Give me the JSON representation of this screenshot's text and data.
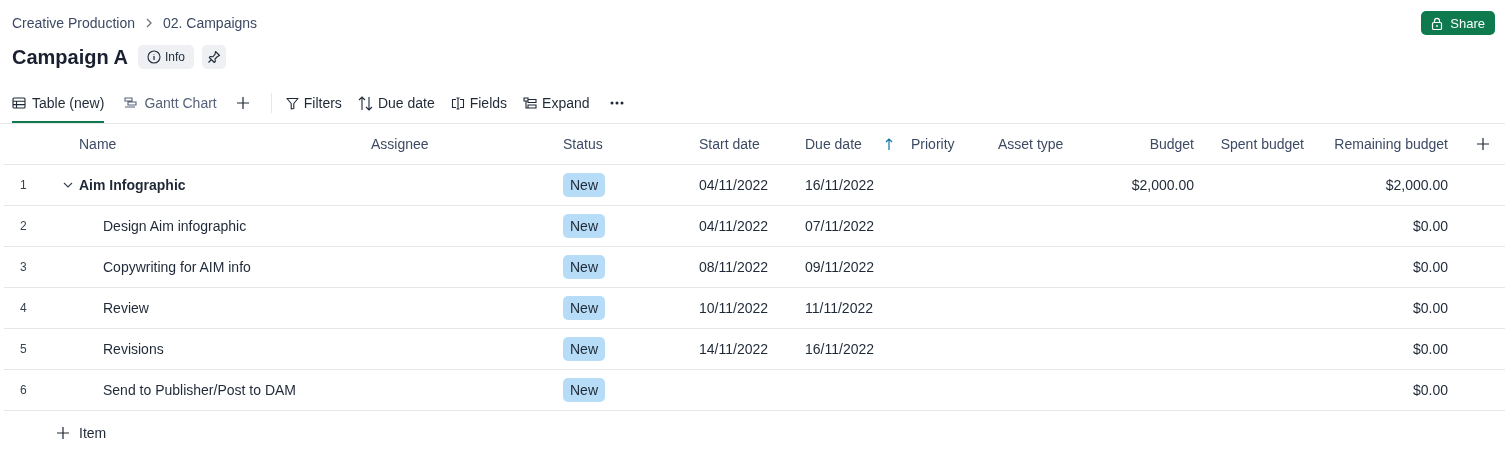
{
  "breadcrumb": [
    "Creative Production",
    "02. Campaigns"
  ],
  "share_button": "Share",
  "title": "Campaign A",
  "info_button": "Info",
  "views": [
    {
      "label": "Table (new)",
      "selected": true
    },
    {
      "label": "Gantt Chart",
      "selected": false
    }
  ],
  "toolbar": [
    "Filters",
    "Due date",
    "Fields",
    "Expand"
  ],
  "table": {
    "columns": [
      {
        "label": "Name",
        "sorted": false
      },
      {
        "label": "Assignee",
        "sorted": false
      },
      {
        "label": "Status",
        "sorted": false
      },
      {
        "label": "Start date",
        "sorted": false
      },
      {
        "label": "Due date",
        "sorted": true
      },
      {
        "label": "Priority",
        "sorted": false
      },
      {
        "label": "Asset type",
        "sorted": false
      },
      {
        "label": "Budget",
        "sorted": false
      },
      {
        "label": "Spent budget",
        "sorted": false
      },
      {
        "label": "Remaining budget",
        "sorted": false
      }
    ],
    "rows": [
      {
        "number": "1",
        "name": "Aim Infographic",
        "status": "New",
        "start_date": "04/11/2022",
        "due_date": "16/11/2022",
        "budget": "$2,000.00",
        "remaining_budget": "$2,000.00",
        "expanded": true,
        "children": [
          {
            "number": "2",
            "name": "Design Aim infographic",
            "status": "New",
            "start_date": "04/11/2022",
            "due_date": "07/11/2022",
            "remaining_budget": "$0.00"
          },
          {
            "number": "3",
            "name": "Copywriting for AIM info",
            "status": "New",
            "start_date": "08/11/2022",
            "due_date": "09/11/2022",
            "remaining_budget": "$0.00"
          },
          {
            "number": "4",
            "name": "Review",
            "status": "New",
            "start_date": "10/11/2022",
            "due_date": "11/11/2022",
            "remaining_budget": "$0.00"
          },
          {
            "number": "5",
            "name": "Revisions",
            "status": "New",
            "start_date": "14/11/2022",
            "due_date": "16/11/2022",
            "remaining_budget": "$0.00"
          },
          {
            "number": "6",
            "name": "Send to Publisher/Post to DAM",
            "status": "New",
            "remaining_budget": "$0.00"
          }
        ]
      }
    ],
    "add_item": "Item"
  }
}
